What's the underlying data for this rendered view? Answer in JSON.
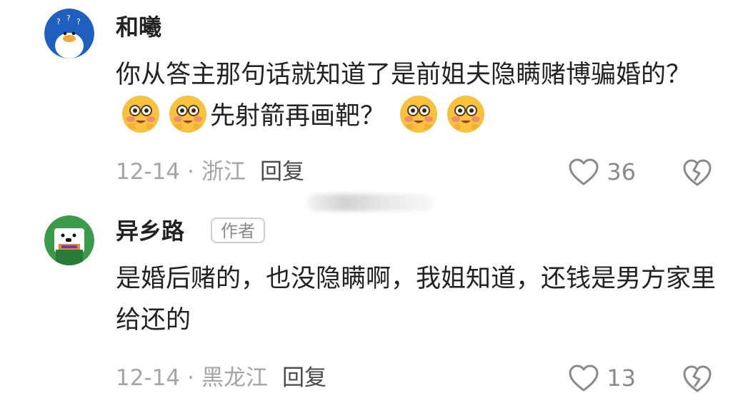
{
  "comments": [
    {
      "username": "和曦",
      "text_parts": [
        "你从答主那句话就知道了是前姐夫隐瞒赌博骗婚的？",
        "先射箭再画靶？"
      ],
      "date": "12-14",
      "separator": "·",
      "location": "浙江",
      "reply_label": "回复",
      "likes": "36",
      "avatar_icon": "duck-question-avatar-icon",
      "emoji_icon": "blushing-emoji-icon"
    },
    {
      "username": "异乡路",
      "badge": "作者",
      "text": "是婚后赌的，也没隐瞒啊，我姐知道，还钱是男方家里给还的",
      "date": "12-14",
      "separator": "·",
      "location": "黑龙江",
      "reply_label": "回复",
      "likes": "13",
      "avatar_icon": "dog-avatar-icon"
    }
  ],
  "colors": {
    "text_primary": "#222222",
    "text_secondary": "#a5a5a5",
    "icon_gray": "#8a8a8a",
    "avatar1_bg": "#1f5fc0",
    "avatar2_bg": "#3a9a4a"
  }
}
